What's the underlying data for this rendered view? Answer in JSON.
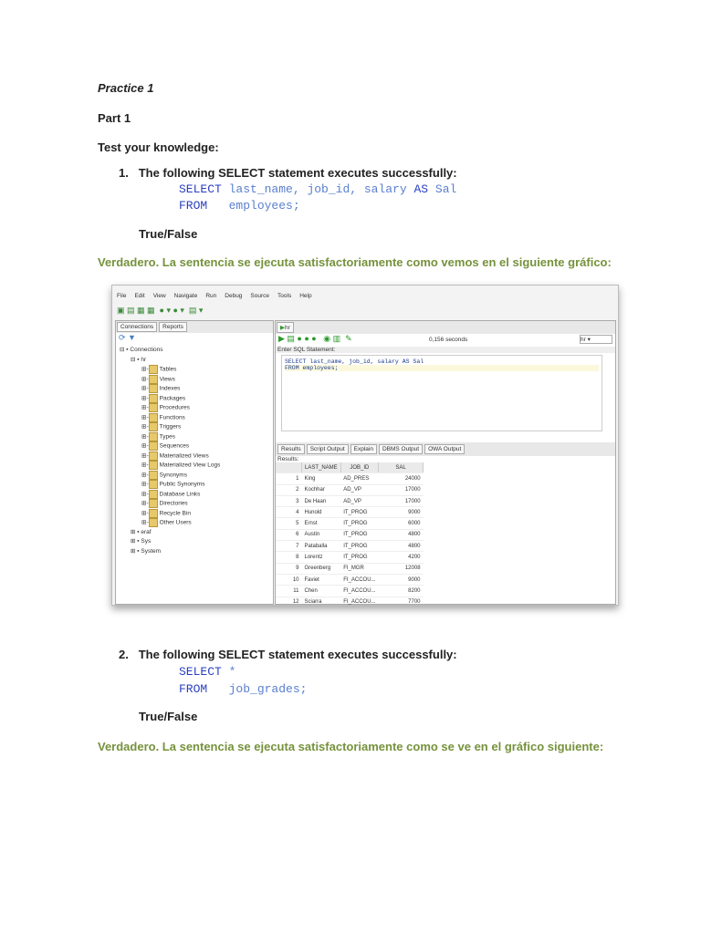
{
  "title": "Practice 1",
  "part": "Part 1",
  "heading": "Test your knowledge:",
  "questions": [
    {
      "num": "1.",
      "text": "The following SELECT statement executes successfully:",
      "code_line1_kw": "SELECT",
      "code_line1": "last_name, job_id, salary",
      "code_line1_as": "AS",
      "code_line1_end": "Sal",
      "code_line2_kw": "FROM",
      "code_line2": "employees;",
      "tf": "True/False",
      "answer": "Verdadero. La sentencia se ejecuta satisfactoriamente como vemos en el siguiente gráfico:"
    },
    {
      "num": "2.",
      "text": "The following SELECT statement executes successfully:",
      "code_line1_kw": "SELECT",
      "code_line1": "*",
      "code_line2_kw": "FROM",
      "code_line2": "job_grades;",
      "tf": "True/False",
      "answer": "Verdadero. La sentencia se ejecuta satisfactoriamente como se ve en el gráfico siguiente:"
    }
  ],
  "screenshot": {
    "menu": [
      "File",
      "Edit",
      "View",
      "Navigate",
      "Run",
      "Debug",
      "Source",
      "Tools",
      "Help"
    ],
    "left_tabs": [
      "Connections",
      "Reports"
    ],
    "tree_root": "Connections",
    "conn_hr": "hr",
    "hr_nodes": [
      "Tables",
      "Views",
      "Indexes",
      "Packages",
      "Procedures",
      "Functions",
      "Triggers",
      "Types",
      "Sequences",
      "Materialized Views",
      "Materialized View Logs",
      "Synonyms",
      "Public Synonyms",
      "Database Links",
      "Directories",
      "Recycle Bin",
      "Other Users"
    ],
    "other_conns": [
      "eraf",
      "Sys",
      "System"
    ],
    "editor_tab": "hr",
    "timing": "0,156 seconds",
    "conn_select": "hr",
    "enter_sql": "Enter SQL Statement:",
    "sql_line1": "SELECT last_name, job_id, salary AS Sal",
    "sql_line2": "FROM employees;",
    "result_tabs": [
      "Results",
      "Script Output",
      "Explain",
      "DBMS Output",
      "OWA Output"
    ],
    "results_label": "Results:",
    "columns": [
      "",
      "LAST_NAME",
      "JOB_ID",
      "SAL"
    ],
    "rows": [
      [
        "1",
        "King",
        "AD_PRES",
        "24000"
      ],
      [
        "2",
        "Kochhar",
        "AD_VP",
        "17000"
      ],
      [
        "3",
        "De Haan",
        "AD_VP",
        "17000"
      ],
      [
        "4",
        "Hunold",
        "IT_PROG",
        "9000"
      ],
      [
        "5",
        "Ernst",
        "IT_PROG",
        "6000"
      ],
      [
        "6",
        "Austin",
        "IT_PROG",
        "4800"
      ],
      [
        "7",
        "Pataballa",
        "IT_PROG",
        "4800"
      ],
      [
        "8",
        "Lorentz",
        "IT_PROG",
        "4200"
      ],
      [
        "9",
        "Greenberg",
        "FI_MGR",
        "12008"
      ],
      [
        "10",
        "Faviet",
        "FI_ACCOU...",
        "9000"
      ],
      [
        "11",
        "Chen",
        "FI_ACCOU...",
        "8200"
      ],
      [
        "12",
        "Sciarra",
        "FI_ACCOU...",
        "7700"
      ]
    ]
  },
  "colors": {
    "answer": "#76923c",
    "code": "#5a7fd0",
    "keyword": "#2a3fc0"
  }
}
